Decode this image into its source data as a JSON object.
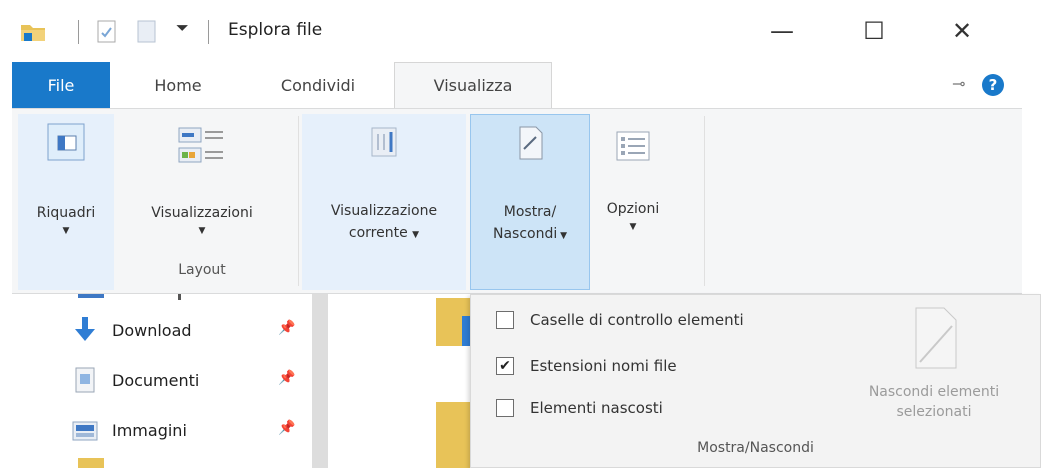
{
  "window": {
    "title": "Esplora file",
    "controls": {
      "minimize": "—",
      "maximize": "☐",
      "close": "✕"
    }
  },
  "ribbon": {
    "tabs": {
      "file": "File",
      "home": "Home",
      "share": "Condividi",
      "view": "Visualizza"
    },
    "help": "?",
    "layout_group": {
      "label": "Layout",
      "panes": "Riquadri",
      "views": "Visualizzazioni"
    },
    "current_view": {
      "line1": "Visualizzazione",
      "line2": "corrente"
    },
    "show_hide": {
      "line1": "Mostra/",
      "line2": "Nascondi"
    },
    "options": "Opzioni"
  },
  "nav": {
    "items": [
      {
        "label": "Download"
      },
      {
        "label": "Documenti"
      },
      {
        "label": "Immagini"
      }
    ]
  },
  "dropdown": {
    "options": [
      {
        "label": "Caselle di controllo elementi",
        "checked": false
      },
      {
        "label": "Estensioni nomi file",
        "checked": true
      },
      {
        "label": "Elementi nascosti",
        "checked": false
      }
    ],
    "hide_selected": {
      "line1": "Nascondi elementi",
      "line2": "selezionati"
    },
    "group_label": "Mostra/Nascondi",
    "check_mark": "✔"
  },
  "colors": {
    "accent": "#1979ca",
    "ribbon_bg": "#f5f6f7",
    "highlight": "#cde4f7"
  }
}
